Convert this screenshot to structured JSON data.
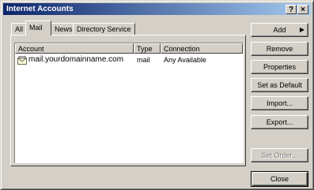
{
  "window": {
    "title": "Internet Accounts",
    "help_label": "?",
    "close_label": "×"
  },
  "tabs": [
    {
      "label": "All"
    },
    {
      "label": "Mail"
    },
    {
      "label": "News"
    },
    {
      "label": "Directory Service"
    }
  ],
  "list": {
    "columns": [
      "Account",
      "Type",
      "Connection"
    ],
    "rows": [
      {
        "account": "mail.yourdomainname.com",
        "type": "mail",
        "connection": "Any Available"
      }
    ]
  },
  "buttons": {
    "add": "Add",
    "remove": "Remove",
    "properties": "Properties",
    "set_default": "Set as Default",
    "import": "Import...",
    "export": "Export...",
    "set_order": "Set Order...",
    "close": "Close"
  },
  "icons": {
    "account_icon": "mail-account-icon",
    "add_arrow": "▶"
  }
}
